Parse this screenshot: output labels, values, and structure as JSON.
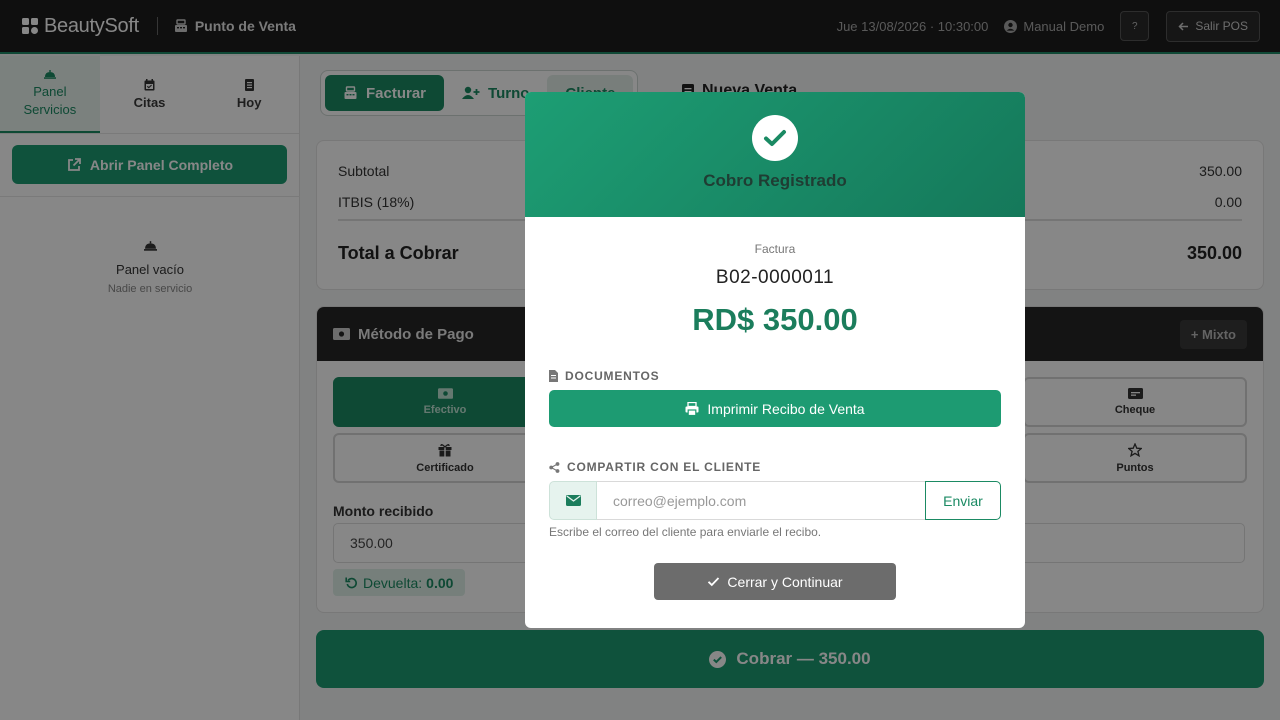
{
  "topbar": {
    "brand": "BeautySoft",
    "module": "Punto de Venta",
    "datetime": "Jue 13/08/2026 · 10:30:00",
    "user": "Manual Demo",
    "help_label": "?",
    "exit_label": "Salir POS"
  },
  "sidebar": {
    "tabs": [
      {
        "label": "Panel\nServicios",
        "icon": "bell-icon"
      },
      {
        "label": "Citas",
        "icon": "calendar-icon"
      },
      {
        "label": "Hoy",
        "icon": "list-icon"
      }
    ],
    "open_panel_label": "Abrir Panel Completo",
    "empty_title": "Panel vacío",
    "empty_sub": "Nadie en servicio"
  },
  "main": {
    "tabs": [
      {
        "label": "Facturar"
      },
      {
        "label": "Turno"
      },
      {
        "label": "Cliente"
      }
    ],
    "new_sale_label": "Nueva Venta",
    "totals": {
      "subtotal_label": "Subtotal",
      "subtotal": "350.00",
      "itbis_label": "ITBIS (18%)",
      "itbis": "0.00",
      "total_label": "Total a Cobrar",
      "total": "350.00"
    },
    "payment": {
      "title": "Método de Pago",
      "mixed_label": "+ Mixto",
      "methods": [
        {
          "label": "Efectivo",
          "icon": "cash-icon",
          "selected": true
        },
        {
          "label": "Cheque",
          "icon": "card-icon"
        },
        {
          "label": "Certificado",
          "icon": "gift-icon"
        },
        {
          "label": "Puntos",
          "icon": "star-icon"
        }
      ],
      "received_label": "Monto recibido",
      "received_value": "350.00",
      "change_label": "Devuelta:",
      "change_value": "0.00"
    },
    "charge_label": "Cobrar — 350.00"
  },
  "modal": {
    "title": "Cobro Registrado",
    "invoice_label": "Factura",
    "invoice_number": "B02-0000011",
    "amount": "RD$ 350.00",
    "documents_label": "DOCUMENTOS",
    "print_label": "Imprimir Recibo de Venta",
    "share_label": "COMPARTIR CON EL CLIENTE",
    "email_placeholder": "correo@ejemplo.com",
    "send_label": "Enviar",
    "email_hint": "Escribe el correo del cliente para enviarle el recibo.",
    "close_label": "Cerrar y Continuar"
  },
  "colors": {
    "accent": "#1b8a63",
    "accent_bright": "#1d9b72",
    "topbar": "#1e1e1e",
    "close_button": "#6c6c6c"
  }
}
